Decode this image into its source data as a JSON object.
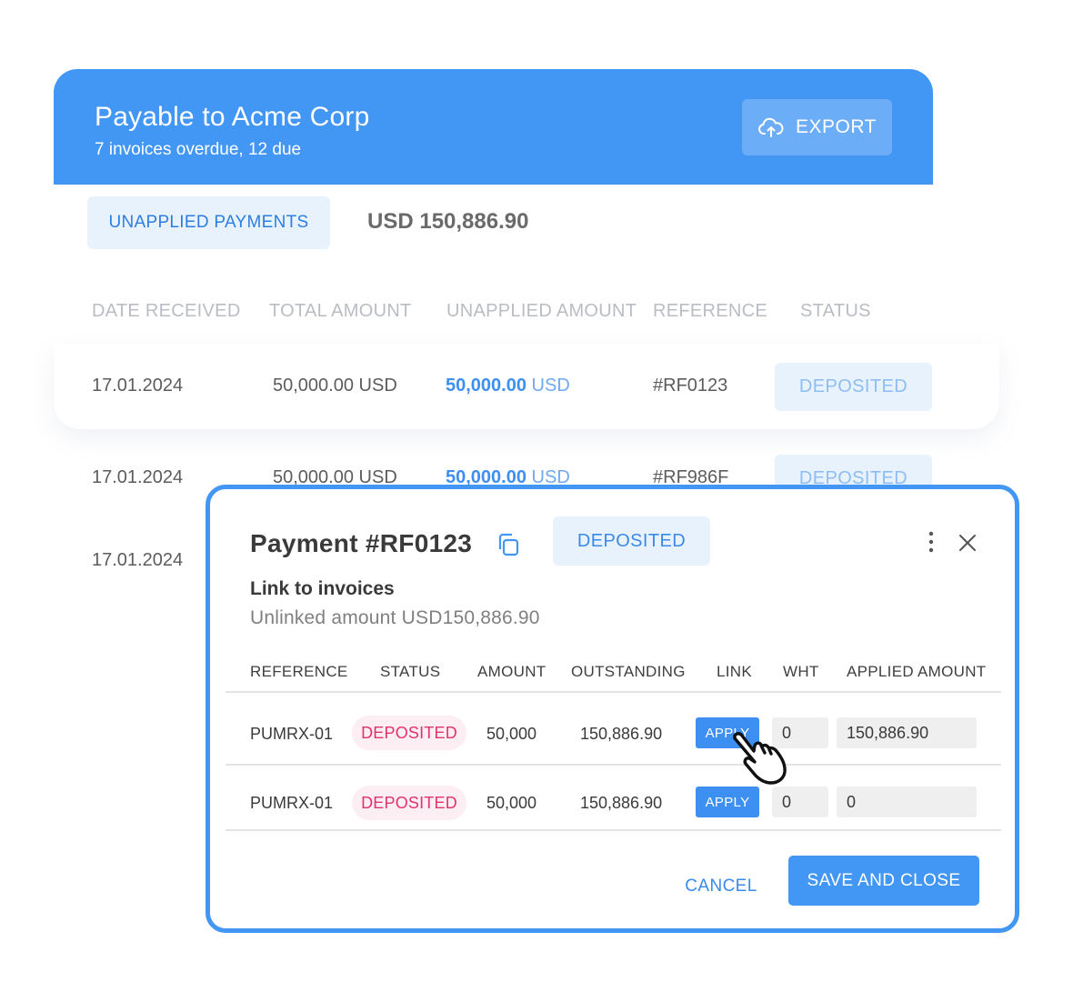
{
  "header": {
    "title": "Payable to Acme Corp",
    "subtitle": "7 invoices overdue, 12 due",
    "export_label": "EXPORT",
    "accent": "#4296f4"
  },
  "summary": {
    "tab_label": "UNAPPLIED PAYMENTS",
    "total": "USD 150,886.90"
  },
  "payments_table": {
    "columns": [
      "DATE RECEIVED",
      "TOTAL AMOUNT",
      "UNAPPLIED AMOUNT",
      "REFERENCE",
      "STATUS"
    ],
    "rows": [
      {
        "date": "17.01.2024",
        "total": "50,000.00 USD",
        "unapplied_value": "50,000.00",
        "unapplied_currency": "USD",
        "reference": "#RF0123",
        "status": "DEPOSITED"
      },
      {
        "date": "17.01.2024",
        "total": "50,000.00 USD",
        "unapplied_value": "50,000.00",
        "unapplied_currency": "USD",
        "reference": "#RF986F",
        "status": "DEPOSITED"
      },
      {
        "date": "17.01.2024"
      }
    ]
  },
  "modal": {
    "title": "Payment #RF0123",
    "status": "DEPOSITED",
    "link_title": "Link to invoices",
    "unlinked": "Unlinked amount USD150,886.90",
    "columns": [
      "REFERENCE",
      "STATUS",
      "AMOUNT",
      "OUTSTANDING",
      "LINK",
      "WHT",
      "APPLIED AMOUNT"
    ],
    "rows": [
      {
        "reference": "PUMRX-01",
        "status": "DEPOSITED",
        "amount": "50,000",
        "outstanding": "150,886.90",
        "link": "APPLY",
        "wht": "0",
        "applied": "150,886.90"
      },
      {
        "reference": "PUMRX-01",
        "status": "DEPOSITED",
        "amount": "50,000",
        "outstanding": "150,886.90",
        "link": "APPLY",
        "wht": "0",
        "applied": "0"
      }
    ],
    "cancel_label": "CANCEL",
    "save_label": "SAVE AND CLOSE",
    "status_color": "#e0336e"
  },
  "icons": {
    "export": "cloud-upload-icon",
    "copy": "copy-icon",
    "more": "more-vertical-icon",
    "close": "close-icon",
    "cursor": "hand-pointer-icon"
  }
}
